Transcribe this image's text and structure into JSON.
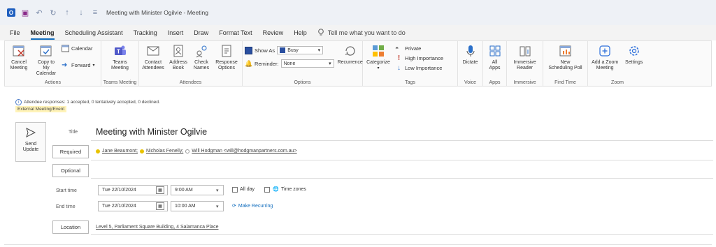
{
  "window": {
    "title": "Meeting with Minister Ogilvie  -  Meeting"
  },
  "menu": {
    "tabs": [
      "File",
      "Meeting",
      "Scheduling Assistant",
      "Tracking",
      "Insert",
      "Draw",
      "Format Text",
      "Review",
      "Help"
    ],
    "active_tab": "Meeting",
    "tell_me": "Tell me what you want to do"
  },
  "ribbon": {
    "actions": {
      "label": "Actions",
      "cancel_meeting": "Cancel\nMeeting",
      "copy_to_calendar": "Copy to My\nCalendar",
      "calendar": "Calendar",
      "forward": "Forward"
    },
    "teams": {
      "label": "Teams Meeting",
      "teams_meeting": "Teams\nMeeting"
    },
    "attendees": {
      "label": "Attendees",
      "contact_attendees": "Contact\nAttendees",
      "address_book": "Address\nBook",
      "check_names": "Check\nNames",
      "response_options": "Response\nOptions"
    },
    "options": {
      "label": "Options",
      "show_as_label": "Show As",
      "show_as_value": "Busy",
      "reminder_label": "Reminder:",
      "reminder_value": "None",
      "recurrence": "Recurrence"
    },
    "tags": {
      "label": "Tags",
      "categorize": "Categorize",
      "private": "Private",
      "high_importance": "High Importance",
      "low_importance": "Low Importance"
    },
    "voice": {
      "label": "Voice",
      "dictate": "Dictate"
    },
    "apps": {
      "label": "Apps",
      "all_apps": "All\nApps"
    },
    "immersive": {
      "label": "Immersive",
      "immersive_reader": "Immersive\nReader"
    },
    "find_time": {
      "label": "Find Time",
      "new_scheduling_poll": "New\nScheduling Poll"
    },
    "zoom": {
      "label": "Zoom",
      "add_zoom_meeting": "Add a Zoom\nMeeting",
      "settings": "Settings"
    }
  },
  "form": {
    "info_text": "Attendee responses: 1 accepted, 0 tentatively accepted, 0 declined.",
    "external_badge": "External Meeting/Event",
    "send_update": "Send\nUpdate",
    "title_label": "Title",
    "title_value": "Meeting with Minister Ogilvie",
    "required_button": "Required",
    "optional_button": "Optional",
    "recipients": [
      {
        "name": "Jane Beaumont;",
        "status": "accepted"
      },
      {
        "name": "Nicholas Fenelly;",
        "status": "accepted"
      },
      {
        "name": "Will Hodgman <will@hodgmanpartners.com.au>",
        "status": "none"
      }
    ],
    "start_time_label": "Start time",
    "start_date": "Tue 22/10/2024",
    "start_time": "9:00 AM",
    "all_day_label": "All day",
    "time_zones_label": "Time zones",
    "end_time_label": "End time",
    "end_date": "Tue 22/10/2024",
    "end_time": "10:00 AM",
    "make_recurring": "Make Recurring",
    "location_button": "Location",
    "location_value": "Level 5, Parliament Square Building, 4 Salamanca Place"
  },
  "colors": {
    "accent": "#0f6cbd",
    "badge_bg": "#fff3b8",
    "accepted": "#e8c200"
  }
}
